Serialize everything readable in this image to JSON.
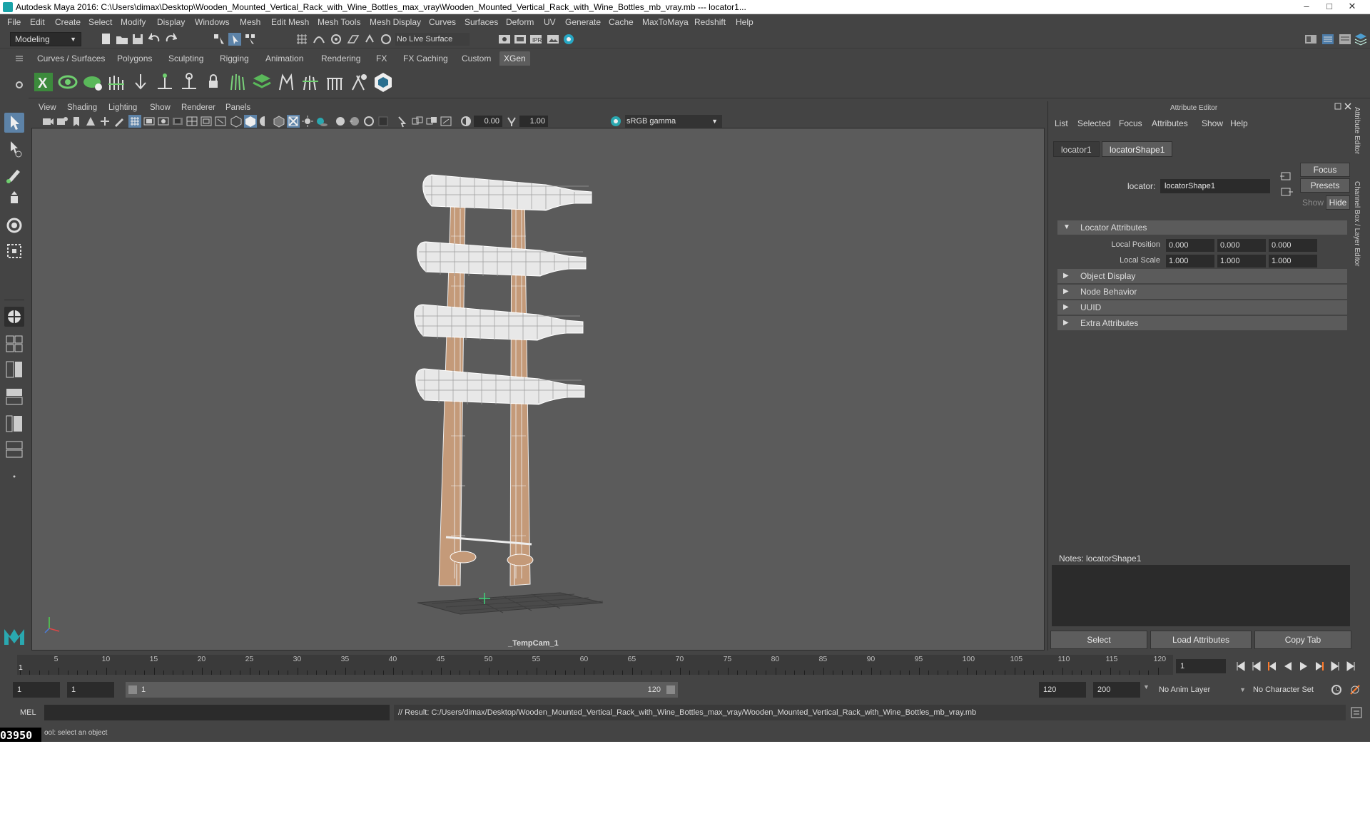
{
  "window": {
    "title": "Autodesk Maya 2016: C:\\Users\\dimax\\Desktop\\Wooden_Mounted_Vertical_Rack_with_Wine_Bottles_max_vray\\Wooden_Mounted_Vertical_Rack_with_Wine_Bottles_mb_vray.mb   ---   locator1...",
    "controls": [
      "–",
      "□",
      "✕"
    ]
  },
  "menubar": [
    "File",
    "Edit",
    "Create",
    "Select",
    "Modify",
    "Display",
    "Windows",
    "Mesh",
    "Edit Mesh",
    "Mesh Tools",
    "Mesh Display",
    "Curves",
    "Surfaces",
    "Deform",
    "UV",
    "Generate",
    "Cache",
    "MaxToMaya",
    "Redshift",
    "Help"
  ],
  "statusline": {
    "mode": "Modeling",
    "live_surface": "No Live Surface"
  },
  "shelf_tabs": [
    "Curves / Surfaces",
    "Polygons",
    "Sculpting",
    "Rigging",
    "Animation",
    "Rendering",
    "FX",
    "FX Caching",
    "Custom",
    "XGen"
  ],
  "active_shelf": "XGen",
  "viewport": {
    "menus": [
      "View",
      "Shading",
      "Lighting",
      "Show",
      "Renderer",
      "Panels"
    ],
    "exposure": "0.00",
    "gamma_value": "1.00",
    "color_space": "sRGB gamma",
    "camera_label": "_TempCam_1"
  },
  "attribute_editor": {
    "title": "Attribute Editor",
    "menus": [
      "List",
      "Selected",
      "Focus",
      "Attributes",
      "Show",
      "Help"
    ],
    "tabs": [
      "locator1",
      "locatorShape1"
    ],
    "active_tab": "locatorShape1",
    "node_label": "locator:",
    "node_value": "locatorShape1",
    "buttons": {
      "focus": "Focus",
      "presets": "Presets",
      "show": "Show",
      "hide": "Hide"
    },
    "sections": [
      {
        "label": "Locator Attributes",
        "expanded": true
      },
      {
        "label": "Object Display",
        "expanded": false
      },
      {
        "label": "Node Behavior",
        "expanded": false
      },
      {
        "label": "UUID",
        "expanded": false
      },
      {
        "label": "Extra Attributes",
        "expanded": false
      }
    ],
    "local_position": {
      "label": "Local Position",
      "values": [
        "0.000",
        "0.000",
        "0.000"
      ]
    },
    "local_scale": {
      "label": "Local Scale",
      "values": [
        "1.000",
        "1.000",
        "1.000"
      ]
    },
    "notes_label": "Notes:  locatorShape1",
    "bottom_buttons": [
      "Select",
      "Load Attributes",
      "Copy Tab"
    ],
    "side_tabs": [
      "Attribute Editor",
      "Channel Box / Layer Editor"
    ]
  },
  "timeline": {
    "tick_labels": [
      "5",
      "10",
      "15",
      "20",
      "25",
      "30",
      "35",
      "40",
      "45",
      "50",
      "55",
      "60",
      "65",
      "70",
      "75",
      "80",
      "85",
      "90",
      "95",
      "100",
      "105",
      "110",
      "115",
      "120"
    ],
    "start_label": "1",
    "current_frame": "1"
  },
  "range": {
    "start": "1",
    "inner_start": "1",
    "slider_start": "1",
    "slider_end": "120",
    "end": "120",
    "max_end": "200",
    "anim_layer": "No Anim Layer",
    "character_set": "No Character Set"
  },
  "command": {
    "language": "MEL",
    "result": "// Result: C:/Users/dimax/Desktop/Wooden_Mounted_Vertical_Rack_with_Wine_Bottles_max_vray/Wooden_Mounted_Vertical_Rack_with_Wine_Bottles_mb_vray.mb"
  },
  "help_line": "ool: select an object",
  "corner_badge": "03950",
  "colors": {
    "maya_bg": "#444444",
    "viewport_bg": "#5b5b5b",
    "field_bg": "#2b2b2b",
    "active_tab": "#5d5d5d",
    "wood": "#c49a79",
    "wire": "#ffffff",
    "accent": "#2aa8b0"
  }
}
